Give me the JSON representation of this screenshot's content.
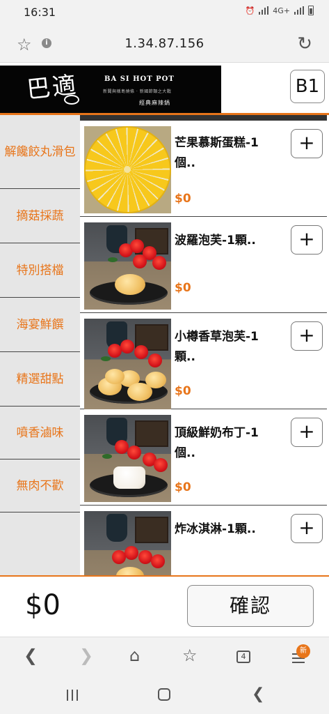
{
  "status_bar": {
    "time": "16:31",
    "network": "4G+"
  },
  "browser": {
    "url": "1.34.87.156",
    "icons": [
      "star-icon",
      "info-icon",
      "reload-icon"
    ]
  },
  "header": {
    "brand_name": "BA SI HOT POT",
    "tagline": "新聞與稱島燒條 · 新國節類之大戰",
    "subtitle": "經典麻辣鍋",
    "table_number": "B1"
  },
  "sidebar": {
    "categories": [
      {
        "label": "解饞餃丸滑包"
      },
      {
        "label": "摘菇採蔬"
      },
      {
        "label": "特別搭檔"
      },
      {
        "label": "海宴鮮饌"
      },
      {
        "label": "精選甜點"
      },
      {
        "label": "噴香滷味"
      },
      {
        "label": "無肉不歡"
      }
    ]
  },
  "products": [
    {
      "name": "芒果慕斯蛋糕-1個..",
      "price": "$0",
      "add_label": "+"
    },
    {
      "name": "波羅泡芙-1顆..",
      "price": "$0",
      "add_label": "+"
    },
    {
      "name": "小樽香草泡芙-1顆..",
      "price": "$0",
      "add_label": "+"
    },
    {
      "name": "頂級鮮奶布丁-1個..",
      "price": "$0",
      "add_label": "+"
    },
    {
      "name": "炸冰淇淋-1顆..",
      "price": "",
      "add_label": "+"
    }
  ],
  "cart": {
    "total": "$0",
    "confirm_label": "確認"
  },
  "browser_nav": {
    "tabs_count": "4",
    "new_badge": "新"
  },
  "colors": {
    "accent": "#e8751a",
    "sidebar_bg": "#e6e6e6"
  }
}
